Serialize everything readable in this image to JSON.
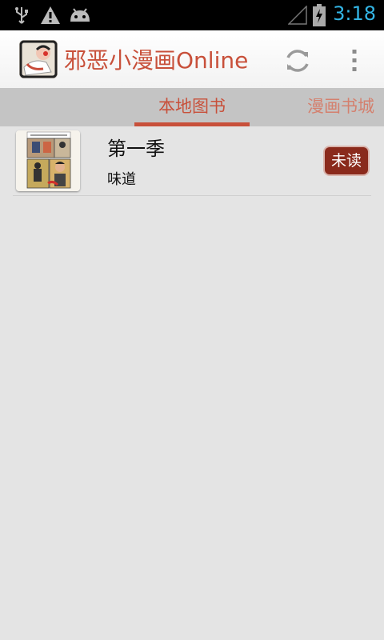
{
  "status_bar": {
    "time": "3:18",
    "icons": [
      "usb-icon",
      "warning-icon",
      "android-icon",
      "signal-icon",
      "battery-charging-icon"
    ]
  },
  "action_bar": {
    "title": "邪恶小漫画Online",
    "logo_icon": "app-logo-icon",
    "refresh_icon": "refresh-icon",
    "overflow_icon": "overflow-menu-icon"
  },
  "tabs": [
    {
      "label": "本地图书",
      "selected": true
    },
    {
      "label": "漫画书城",
      "selected": false
    }
  ],
  "books": [
    {
      "title": "第一季",
      "subtitle": "味道",
      "status": "未读",
      "cover_icon": "comic-cover-thumbnail"
    }
  ],
  "colors": {
    "accent": "#c8503a",
    "badge": "#8a2a1c",
    "time": "#33b5e5"
  }
}
